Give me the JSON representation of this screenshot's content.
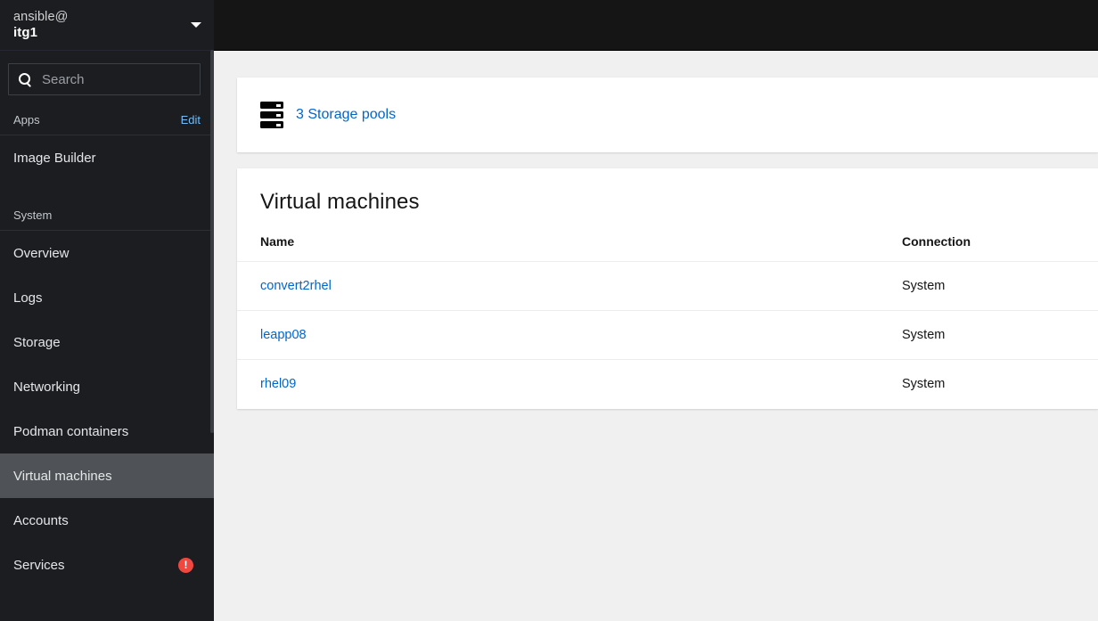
{
  "sidebar": {
    "host": {
      "user": "ansible@",
      "hostname": "itg1",
      "caret_icon": "chevron-down-icon"
    },
    "search": {
      "placeholder": "Search",
      "value": "",
      "icon": "search-icon"
    },
    "groups": [
      {
        "label": "Apps",
        "action_label": "Edit",
        "items": [
          {
            "label": "Image Builder",
            "active": false,
            "badge": ""
          }
        ]
      },
      {
        "label": "System",
        "action_label": "",
        "items": [
          {
            "label": "Overview",
            "active": false,
            "badge": ""
          },
          {
            "label": "Logs",
            "active": false,
            "badge": ""
          },
          {
            "label": "Storage",
            "active": false,
            "badge": ""
          },
          {
            "label": "Networking",
            "active": false,
            "badge": ""
          },
          {
            "label": "Podman containers",
            "active": false,
            "badge": ""
          },
          {
            "label": "Virtual machines",
            "active": true,
            "badge": ""
          },
          {
            "label": "Accounts",
            "active": false,
            "badge": ""
          },
          {
            "label": "Services",
            "active": false,
            "badge": "!"
          }
        ]
      }
    ]
  },
  "main": {
    "storage_pools": {
      "icon": "storage-pools-icon",
      "link_label": "3 Storage pools",
      "count": 3
    },
    "virtual_machines": {
      "title": "Virtual machines",
      "columns": [
        "Name",
        "Connection"
      ],
      "rows": [
        {
          "name": "convert2rhel",
          "connection": "System"
        },
        {
          "name": "leapp08",
          "connection": "System"
        },
        {
          "name": "rhel09",
          "connection": "System"
        }
      ]
    }
  },
  "colors": {
    "sidebar_bg": "#1b1d21",
    "sidebar_active": "#4f5357",
    "topbar_bg": "#151515",
    "link_blue": "#0066cc",
    "sidebar_link_blue": "#73bcf7",
    "badge_red": "#f0483e",
    "page_bg": "#f0f0f0",
    "card_bg": "#ffffff"
  }
}
